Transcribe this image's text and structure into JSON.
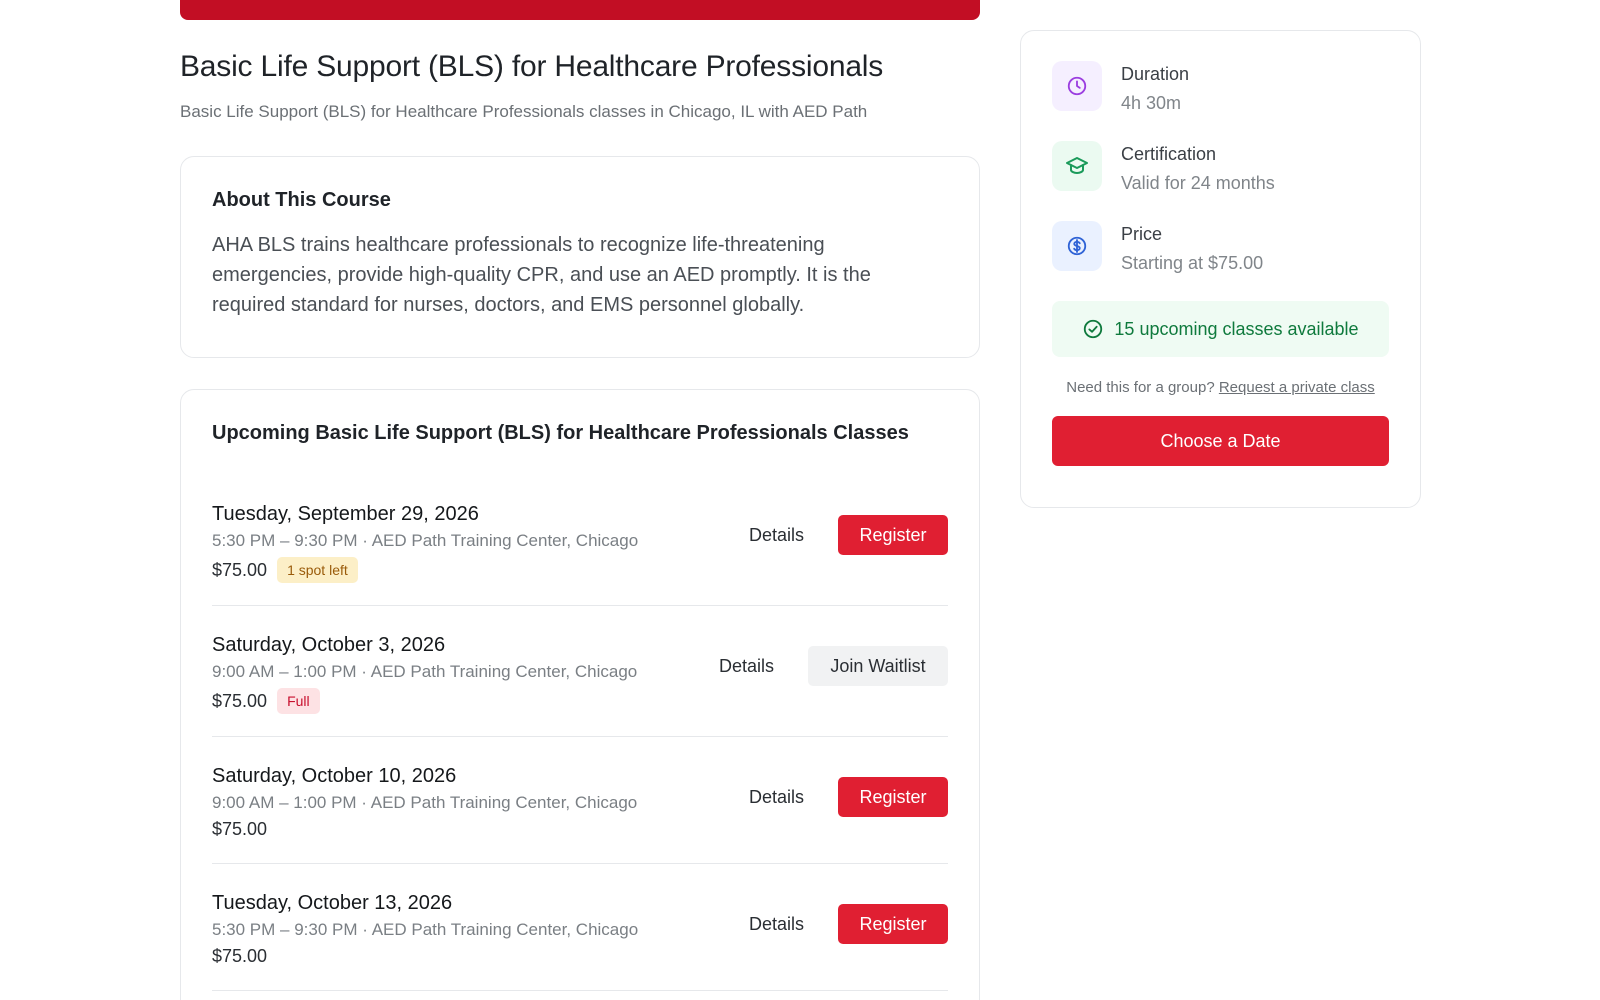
{
  "course": {
    "title": "Basic Life Support (BLS) for Healthcare Professionals",
    "subtitle": "Basic Life Support (BLS) for Healthcare Professionals classes in Chicago, IL with AED Path"
  },
  "about": {
    "heading": "About This Course",
    "text": "AHA BLS trains healthcare professionals to recognize life-threatening emergencies, provide high-quality CPR, and use an AED promptly. It is the required standard for nurses, doctors, and EMS personnel globally."
  },
  "classes": {
    "heading": "Upcoming Basic Life Support (BLS) for Healthcare Professionals Classes",
    "items": [
      {
        "date": "Tuesday, September 29, 2026",
        "meta": "5:30 PM – 9:30 PM · AED Path Training Center, Chicago",
        "price": "$75.00",
        "badge": "1 spot left",
        "details_label": "Details",
        "action_label": "Register"
      },
      {
        "date": "Saturday, October 3, 2026",
        "meta": "9:00 AM – 1:00 PM · AED Path Training Center, Chicago",
        "price": "$75.00",
        "badge": "Full",
        "details_label": "Details",
        "action_label": "Join Waitlist"
      },
      {
        "date": "Saturday, October 10, 2026",
        "meta": "9:00 AM – 1:00 PM · AED Path Training Center, Chicago",
        "price": "$75.00",
        "details_label": "Details",
        "action_label": "Register"
      },
      {
        "date": "Tuesday, October 13, 2026",
        "meta": "5:30 PM – 9:30 PM · AED Path Training Center, Chicago",
        "price": "$75.00",
        "details_label": "Details",
        "action_label": "Register"
      }
    ]
  },
  "sidebar": {
    "duration": {
      "label": "Duration",
      "value": "4h 30m",
      "icon": "clock-icon"
    },
    "certification": {
      "label": "Certification",
      "value": "Valid for 24 months",
      "icon": "graduation-cap-icon"
    },
    "price": {
      "label": "Price",
      "value": "Starting at $75.00",
      "icon": "dollar-icon"
    },
    "availability": "15 upcoming classes available",
    "group_prompt": "Need this for a group?",
    "group_link": "Request a private class",
    "cta": "Choose a Date"
  },
  "colors": {
    "brand_red": "#e01f32",
    "success_green": "#0f7a3d",
    "icon_purple": "#9b3de0",
    "icon_green": "#1a9a5a",
    "icon_blue": "#2f63d6"
  }
}
